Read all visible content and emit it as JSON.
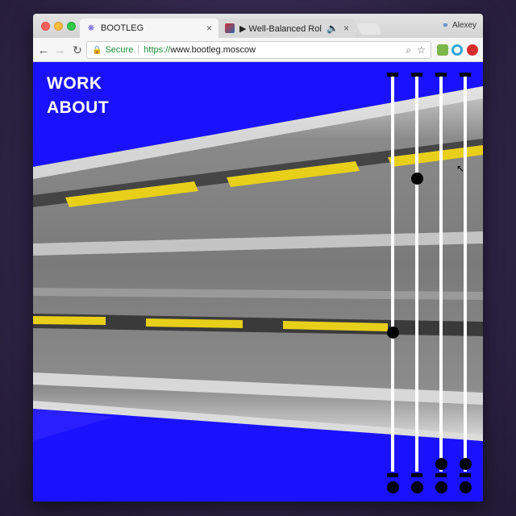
{
  "browser": {
    "tabs": [
      {
        "title": "BOOTLEG",
        "close": "×",
        "favicon": "bootleg-favicon"
      },
      {
        "title": "▶ Well-Balanced Rollback",
        "close": "×",
        "favicon": "video-favicon",
        "audio": "🔈"
      }
    ],
    "profile_name": "Alexey",
    "address": {
      "secure_label": "Secure",
      "scheme": "https://",
      "host": "www.bootleg.moscow"
    },
    "icons": {
      "back": "←",
      "forward": "→",
      "reload": "↻",
      "lock": "🔒",
      "zoom": "⌕",
      "star": "☆",
      "profile": "⚭",
      "cursor": "↖"
    }
  },
  "site": {
    "nav": {
      "work": "WORK",
      "about": "ABOUT"
    },
    "colors": {
      "background": "#1a12ff",
      "text": "#ffffff",
      "slider_track": "#ffffff",
      "slider_knob": "#000000"
    },
    "sliders": [
      {
        "name": "slider-1",
        "value": 0.35
      },
      {
        "name": "slider-2",
        "value": 0.76
      },
      {
        "name": "slider-3",
        "value": 0.0
      },
      {
        "name": "slider-4",
        "value": 0.0
      }
    ]
  }
}
